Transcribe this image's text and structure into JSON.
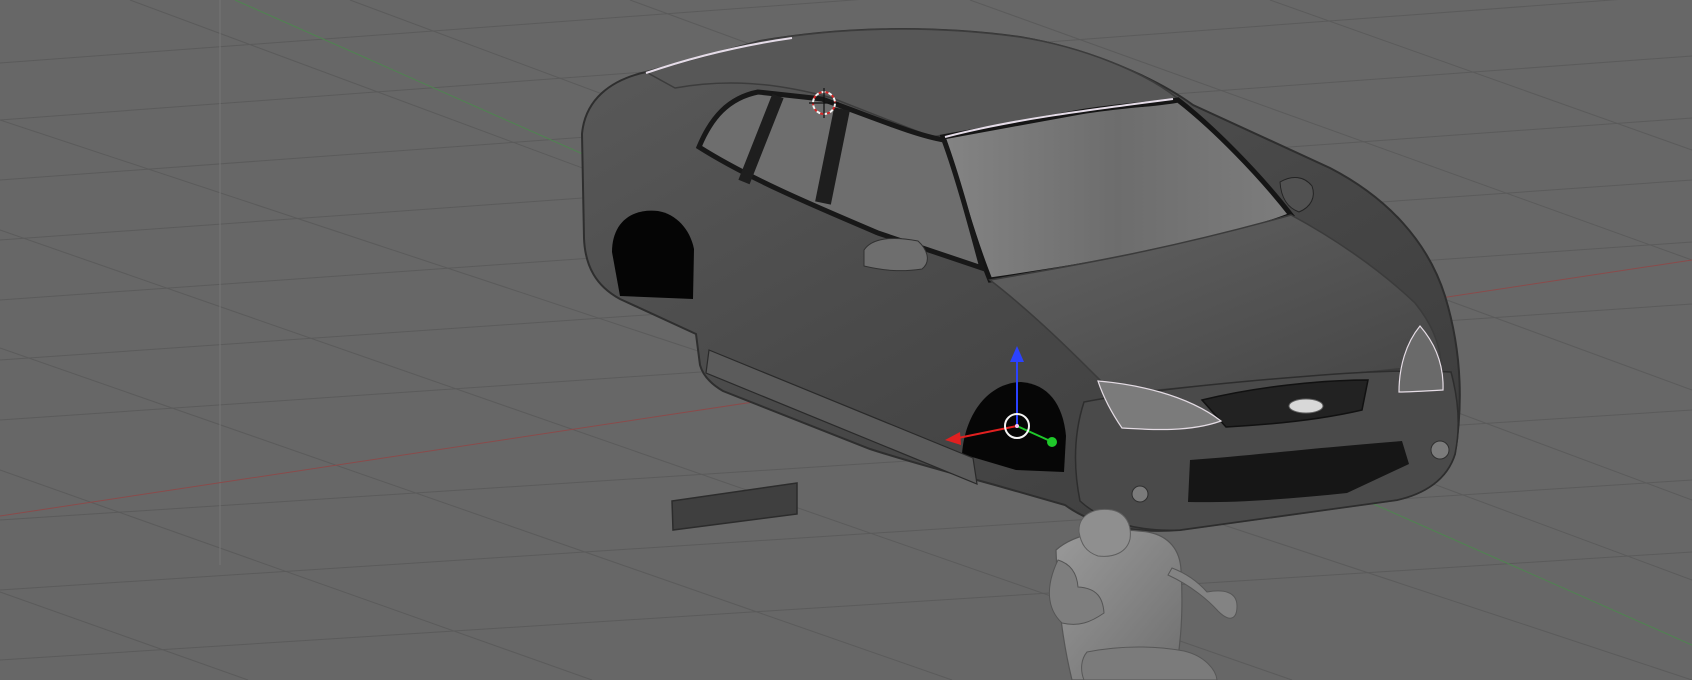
{
  "viewport": {
    "background": "#676767",
    "grid_color": "#5b5b5b",
    "x_axis_color": "#8a4b4b",
    "y_axis_color": "#4f8450",
    "z_axis_color": "#2c3cff"
  },
  "scene": {
    "car_body_color": "#4b4b4b",
    "window_color": "#2c2c2c",
    "glass_color": "#6f6f6f",
    "ground_object_color": "#3f3f3f",
    "character_color": "#858585"
  },
  "cursor": {
    "icon": "3d-cursor-icon"
  },
  "manipulator": {
    "icons": [
      "x-axis-arrow-icon",
      "y-axis-arrow-icon",
      "z-axis-arrow-icon",
      "rotate-center-icon"
    ]
  }
}
